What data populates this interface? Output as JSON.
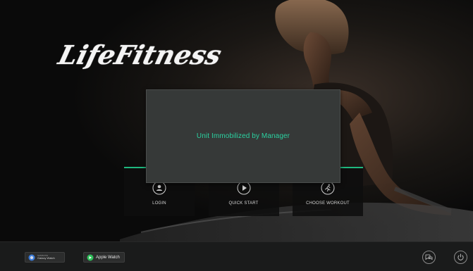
{
  "brand": {
    "logo_text": "LifeFitness"
  },
  "modal": {
    "message": "Unit Immobilized by Manager"
  },
  "tiles": [
    {
      "id": "login",
      "label": "LOGIN",
      "icon": "user-icon"
    },
    {
      "id": "quick-start",
      "label": "QUICK START",
      "icon": "play-icon"
    },
    {
      "id": "choose-workout",
      "label": "CHOOSE WORKOUT",
      "icon": "runner-icon"
    }
  ],
  "footer": {
    "samsung_badge": {
      "line1": "SAMSUNG",
      "line2": "Galaxy Watch"
    },
    "apple_badge": {
      "line1": "Apple Watch"
    },
    "buttons": [
      "language-icon",
      "power-icon"
    ]
  },
  "colors": {
    "accent_green": "#1fb87f",
    "message_green": "#2bd1a0",
    "modal_bg": "#363938",
    "footer_bg": "#1a1b1b"
  }
}
